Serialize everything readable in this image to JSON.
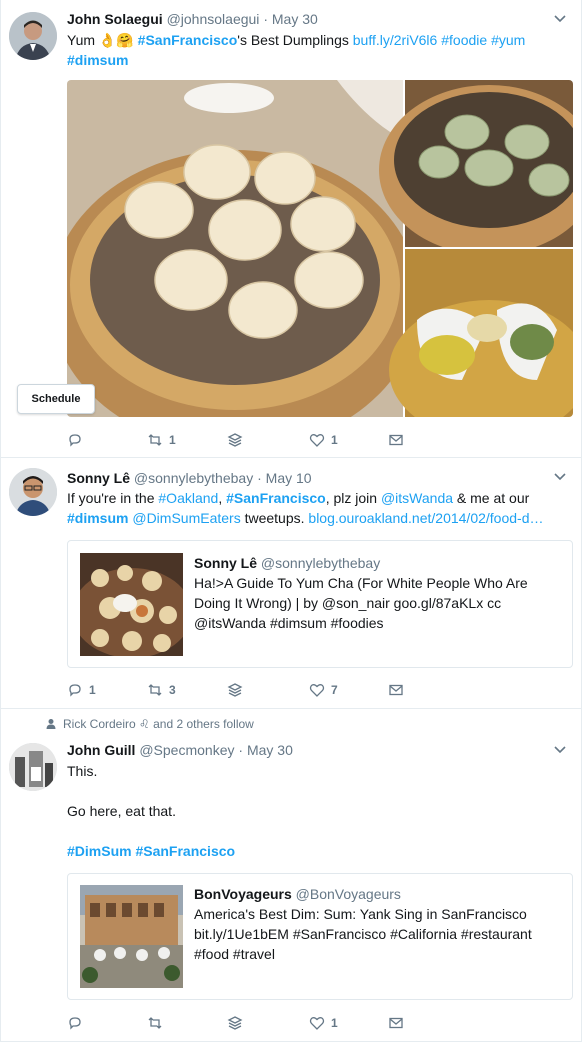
{
  "tweets": [
    {
      "name": "John Solaegui",
      "handle": "@johnsolaegui",
      "date": "May 30",
      "text_parts": [
        "Yum 👌🤗 ",
        "#SanFrancisco",
        "'s Best Dumplings ",
        "buff.ly/2riV6l6",
        " ",
        "#foodie",
        " ",
        "#yum"
      ],
      "text_line2": "#dimsum",
      "schedule_label": "Schedule",
      "replies": "",
      "retweets": "1",
      "likes": "1"
    },
    {
      "name": "Sonny Lê",
      "handle": "@sonnylebythebay",
      "date": "May 10",
      "line1_parts": [
        "If you're in the ",
        "#Oakland",
        ", ",
        "#SanFrancisco",
        ", plz join ",
        "@itsWanda",
        " & me at our"
      ],
      "line2_parts": [
        "#dimsum",
        " ",
        "@DimSumEaters",
        " tweetups. ",
        "blog.ouroakland.net/2014/02/food-d…"
      ],
      "quote": {
        "name": "Sonny Lê",
        "handle": "@sonnylebythebay",
        "line1": "Ha!>A Guide To Yum Cha (For White People Who Are",
        "line2": "Doing It Wrong) | by @son_nair goo.gl/87aKLx cc",
        "line3": "@itsWanda #dimsum #foodies"
      },
      "replies": "1",
      "retweets": "3",
      "likes": "7"
    },
    {
      "context": "Rick Cordeiro ♌ and 2 others follow",
      "name": "John Guill",
      "handle": "@Specmonkey",
      "date": "May 30",
      "line1": "This.",
      "line2": "Go here, eat that.",
      "tags": [
        "#DimSum",
        "#SanFrancisco"
      ],
      "quote": {
        "name": "BonVoyageurs",
        "handle": "@BonVoyageurs",
        "line1": "America's Best Dim: Sum: Yank Sing in SanFrancisco",
        "line2": "bit.ly/1Ue1bEM #SanFrancisco #California #restaurant",
        "line3": "#food #travel"
      },
      "replies": "",
      "retweets": "",
      "likes": "1"
    }
  ],
  "colors": {
    "link": "#1da1f2",
    "muted": "#657786",
    "border": "#e6ecf0"
  },
  "icons": [
    "reply-icon",
    "retweet-icon",
    "stack-icon",
    "heart-icon",
    "message-icon",
    "caret-down-icon",
    "person-icon"
  ]
}
